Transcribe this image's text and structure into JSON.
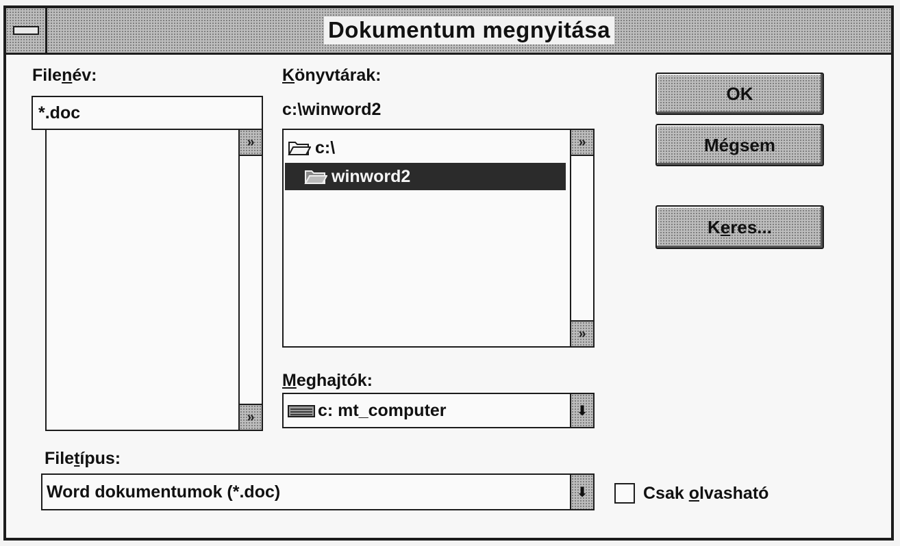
{
  "window": {
    "title": "Dokumentum megnyitása",
    "system_menu_icon": "system-menu-icon"
  },
  "filename": {
    "label_pre": "File",
    "label_key": "n",
    "label_post": "év:",
    "value": "*.doc",
    "files": []
  },
  "directories": {
    "label_key": "K",
    "label_post": "önyvtárak:",
    "current_path": "c:\\winword2",
    "items": [
      {
        "label": "c:\\",
        "icon": "open-folder-icon",
        "selected": false
      },
      {
        "label": "winword2",
        "icon": "open-folder-icon",
        "selected": true
      }
    ]
  },
  "drives": {
    "label_key": "M",
    "label_post": "eghajtók:",
    "value": "c: mt_computer",
    "icon": "hard-drive-icon"
  },
  "filetype": {
    "label_pre": "File",
    "label_key": "t",
    "label_post": "ípus:",
    "value": "Word dokumentumok (*.doc)"
  },
  "readonly": {
    "label_pre": "Csak ",
    "label_key": "o",
    "label_post": "lvasható",
    "checked": false
  },
  "buttons": {
    "ok": "OK",
    "cancel": "Mégsem",
    "find_pre": "K",
    "find_key": "e",
    "find_post": "res..."
  },
  "colors": {
    "frame": "#1c1c1c",
    "selection": "#2b2b2b",
    "button_face": "#bdbdbd"
  }
}
